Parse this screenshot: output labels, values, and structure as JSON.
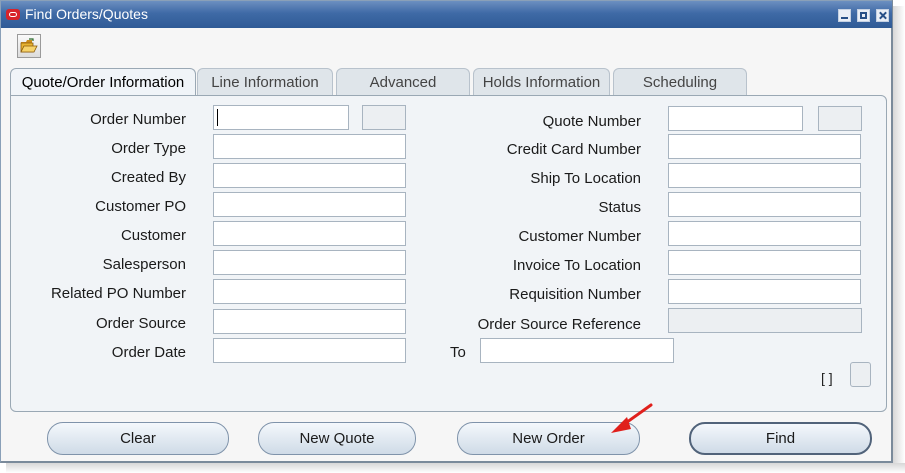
{
  "window": {
    "title": "Find  Orders/Quotes"
  },
  "tabs": [
    {
      "label": "Quote/Order Information",
      "active": true
    },
    {
      "label": "Line Information",
      "active": false
    },
    {
      "label": "Advanced",
      "active": false
    },
    {
      "label": "Holds Information",
      "active": false
    },
    {
      "label": "Scheduling",
      "active": false
    }
  ],
  "left_fields": [
    {
      "label": "Order Number",
      "value": ""
    },
    {
      "label": "Order Type",
      "value": ""
    },
    {
      "label": "Created By",
      "value": ""
    },
    {
      "label": "Customer PO",
      "value": ""
    },
    {
      "label": "Customer",
      "value": ""
    },
    {
      "label": "Salesperson",
      "value": ""
    },
    {
      "label": "Related PO Number",
      "value": ""
    },
    {
      "label": "Order Source",
      "value": ""
    },
    {
      "label": "Order Date",
      "value": ""
    }
  ],
  "right_fields": [
    {
      "label": "Quote Number",
      "value": ""
    },
    {
      "label": "Credit Card Number",
      "value": ""
    },
    {
      "label": "Ship To Location",
      "value": ""
    },
    {
      "label": "Status",
      "value": ""
    },
    {
      "label": "Customer Number",
      "value": ""
    },
    {
      "label": "Invoice To Location",
      "value": ""
    },
    {
      "label": "Requisition Number",
      "value": ""
    },
    {
      "label": "Order Source Reference",
      "value": ""
    }
  ],
  "order_date_to": {
    "label": "To",
    "value": ""
  },
  "brackets_text": "[ ]",
  "buttons": {
    "clear": "Clear",
    "new_quote": "New Quote",
    "new_order": "New Order",
    "find": "Find"
  },
  "icons": {
    "toolbar": "open-folder-icon",
    "window_controls": [
      "minimize-icon",
      "maximize-icon",
      "close-icon"
    ],
    "annotation": "red-arrow-icon"
  },
  "colors": {
    "titlebar": "#3f6aa6",
    "annotation_arrow": "#e0201c",
    "oracle_logo": "#d8232a"
  }
}
